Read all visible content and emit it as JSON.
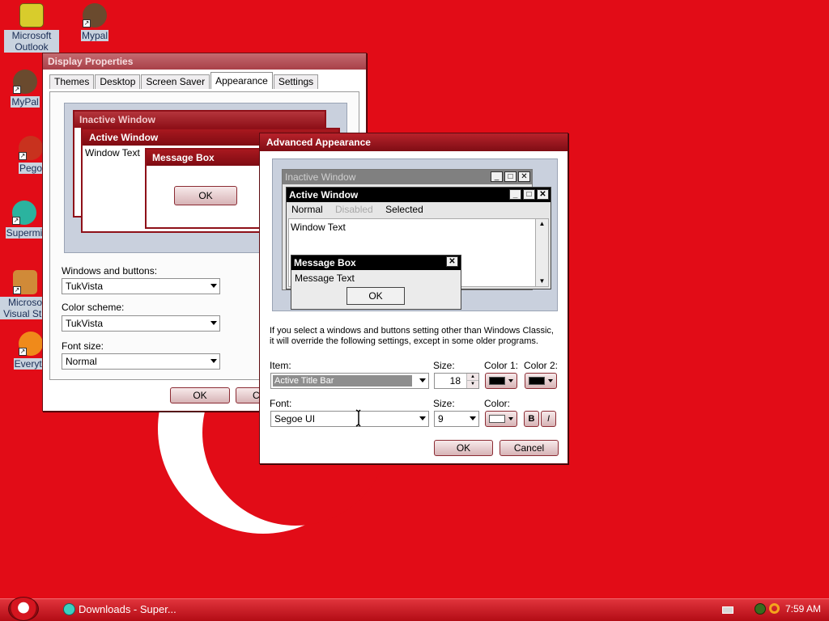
{
  "desktop_icons": [
    {
      "label": "Microsoft Outlook",
      "color": "#d8cc2c"
    },
    {
      "label": "Mypal",
      "color": "#6a4a2e"
    },
    {
      "label": "MyPal",
      "color": "#6a4a2e"
    },
    {
      "label": "Pego",
      "color": "#c8321e"
    },
    {
      "label": "Supermi",
      "color": "#2bb39f"
    },
    {
      "label": "Microso Visual Stu",
      "color": "#d08a38"
    },
    {
      "label": "Everyth",
      "color": "#f08a1a"
    }
  ],
  "display_properties": {
    "title": "Display Properties",
    "tabs": [
      "Themes",
      "Desktop",
      "Screen Saver",
      "Appearance",
      "Settings"
    ],
    "active_tab": "Appearance",
    "preview": {
      "inactive_window": "Inactive Window",
      "active_window": "Active Window",
      "window_text": "Window Text",
      "message_box": "Message Box",
      "ok": "OK"
    },
    "windows_and_buttons_label": "Windows and buttons:",
    "windows_and_buttons_value": "TukVista",
    "color_scheme_label": "Color scheme:",
    "color_scheme_value": "TukVista",
    "font_size_label": "Font size:",
    "font_size_value": "Normal",
    "ok_button": "OK",
    "cancel_button": "C"
  },
  "advanced_appearance": {
    "title": "Advanced Appearance",
    "preview": {
      "inactive_window": "Inactive Window",
      "active_window": "Active Window",
      "menu_normal": "Normal",
      "menu_disabled": "Disabled",
      "menu_selected": "Selected",
      "window_text": "Window Text",
      "message_box": "Message Box",
      "message_text": "Message Text",
      "ok": "OK"
    },
    "info_line1": "If you select a windows and buttons setting other than Windows Classic,",
    "info_line2": "it will override the following settings, except in some older programs.",
    "item_label": "Item:",
    "item_value": "Active Title Bar",
    "size_label": "Size:",
    "item_size_value": "18",
    "color1_label": "Color 1:",
    "color2_label": "Color 2:",
    "color1_value": "#000000",
    "color2_value": "#000000",
    "font_label": "Font:",
    "font_value": "Segoe UI",
    "font_size_label": "Size:",
    "font_size_value": "9",
    "font_color_label": "Color:",
    "font_color_value": "#ffffff",
    "bold_button": "B",
    "italic_button": "I",
    "ok_button": "OK",
    "cancel_button": "Cancel"
  },
  "taskbar": {
    "task_item": "Downloads - Super...",
    "clock": "7:59 AM"
  },
  "colors": {
    "desktop_background": "#e20c17",
    "titlebar_active": "#8e1018",
    "button_face": "#e9cfd1"
  }
}
